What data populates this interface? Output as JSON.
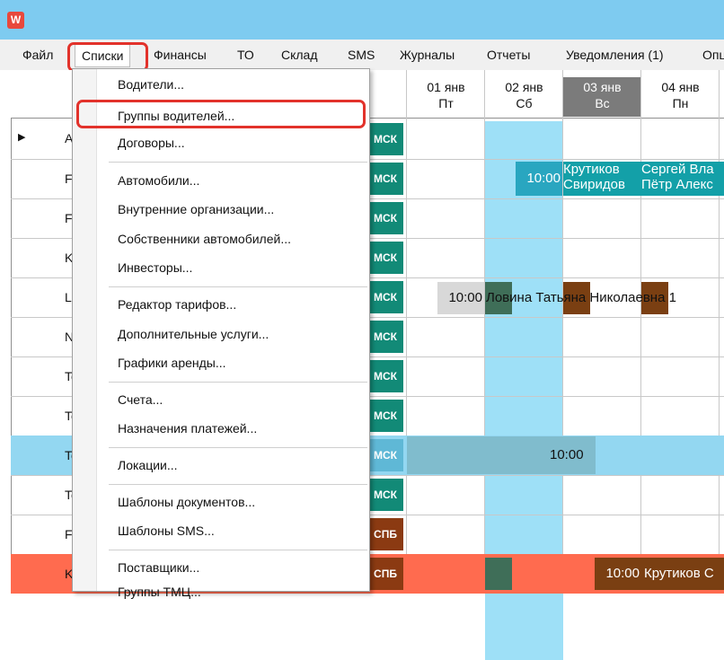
{
  "app": {
    "icon_letter": "W"
  },
  "menubar": {
    "items": [
      "Файл",
      "Списки",
      "Финансы",
      "ТО",
      "Склад",
      "SMS",
      "Журналы",
      "Отчеты",
      "Уведомления (1)",
      "Опц"
    ]
  },
  "calendar": {
    "days": [
      {
        "date": "01 янв",
        "dow": "Пт"
      },
      {
        "date": "02 янв",
        "dow": "Сб"
      },
      {
        "date": "03 янв",
        "dow": "Вс"
      },
      {
        "date": "04 янв",
        "dow": "Пн"
      }
    ],
    "rows": [
      {
        "label": "Au",
        "city": "МСК"
      },
      {
        "label": "Fo",
        "city": "МСК"
      },
      {
        "label": "Fo",
        "city": "МСК"
      },
      {
        "label": "Kia",
        "city": "МСК"
      },
      {
        "label": "La",
        "city": "МСК"
      },
      {
        "label": "Nis",
        "city": "МСК"
      },
      {
        "label": "To",
        "city": "МСК"
      },
      {
        "label": "To",
        "city": "МСК"
      },
      {
        "label": "To",
        "city": "МСК"
      },
      {
        "label": "To",
        "city": "МСК"
      },
      {
        "label": "Fo",
        "city": "СПБ"
      },
      {
        "label": "Kia",
        "city": "СПБ"
      }
    ],
    "events": {
      "row2_time": "10:00",
      "row2_line1a": "Крутиков",
      "row2_line1b": "Сергей Вла",
      "row2_line2a": "Свиридов",
      "row2_line2b": "Пётр Алекс",
      "row5_time": "10:00",
      "row5_name": "Ловина Татьяна Николаевна 1",
      "row9_time": "10:00",
      "row12_time": "10:00",
      "row12_name": "Крутиков С"
    }
  },
  "dropdown": {
    "items": [
      "Водители...",
      "Группы водителей...",
      "Договоры...",
      "Автомобили...",
      "Внутренние организации...",
      "Собственники автомобилей...",
      "Инвесторы...",
      "Редактор тарифов...",
      "Дополнительные услуги...",
      "Графики аренды...",
      "Счета...",
      "Назначения платежей...",
      "Локации...",
      "Шаблоны документов...",
      "Шаблоны SMS...",
      "Поставщики...",
      "Группы ТМЦ..."
    ]
  },
  "colors": {
    "accent_red": "#e2322b",
    "msk": "#128a77",
    "spb": "#8b3a12",
    "title": "#7ecbf0"
  }
}
